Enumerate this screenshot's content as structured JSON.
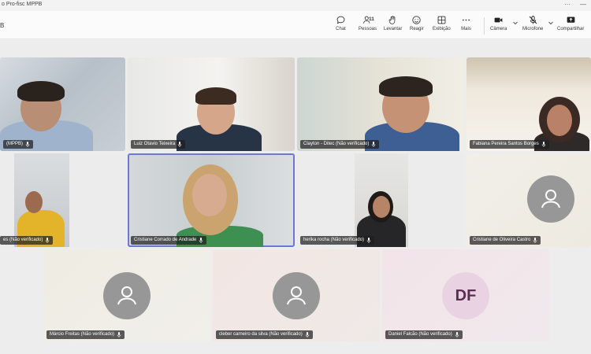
{
  "window": {
    "title": "o Pro-fisc MPPB",
    "controls": [
      "···",
      "—"
    ]
  },
  "toolbar": {
    "meeting_label": "B",
    "participant_count": "11",
    "buttons": [
      {
        "id": "chat",
        "label": "Chat",
        "icon": "chat-icon"
      },
      {
        "id": "people",
        "label": "Pessoas",
        "icon": "people-icon"
      },
      {
        "id": "raise",
        "label": "Levantar",
        "icon": "raise-hand-icon"
      },
      {
        "id": "react",
        "label": "Reagir",
        "icon": "emoji-icon"
      },
      {
        "id": "view",
        "label": "Exibição",
        "icon": "view-grid-icon"
      },
      {
        "id": "more",
        "label": "Mais",
        "icon": "more-icon"
      },
      {
        "id": "camera",
        "label": "Câmera",
        "icon": "camera-icon"
      },
      {
        "id": "mic",
        "label": "Microfone",
        "icon": "mic-muted-icon"
      },
      {
        "id": "share",
        "label": "Compartilhar",
        "icon": "share-icon"
      }
    ]
  },
  "participants": [
    {
      "name": "(MPPB)",
      "type": "video"
    },
    {
      "name": "Luiz Otavio Teixeira",
      "type": "video"
    },
    {
      "name": "Clayton - Ditec (Não verificado)",
      "type": "video"
    },
    {
      "name": "Fabiana Pereira Santos Borges",
      "type": "video"
    },
    {
      "name": "es (Não verificado)",
      "type": "video"
    },
    {
      "name": "Cristiane Corrado de Andrade",
      "type": "video",
      "active": true
    },
    {
      "name": "herika rocha (Não verificado)",
      "type": "video"
    },
    {
      "name": "Cristiane de Oliveira Castro",
      "type": "avatar"
    },
    {
      "name": "Márcio Freitas (Não verificado)",
      "type": "avatar"
    },
    {
      "name": "cleber carneiro da silva (Não verificado)",
      "type": "avatar"
    },
    {
      "name": "Daniel Falcão (Não verificado)",
      "type": "initials",
      "initials": "DF"
    }
  ],
  "colors": {
    "active_outline": "#6f77d6",
    "avatar_gray": "#979797",
    "avatar_df": "#e9d3e3"
  }
}
